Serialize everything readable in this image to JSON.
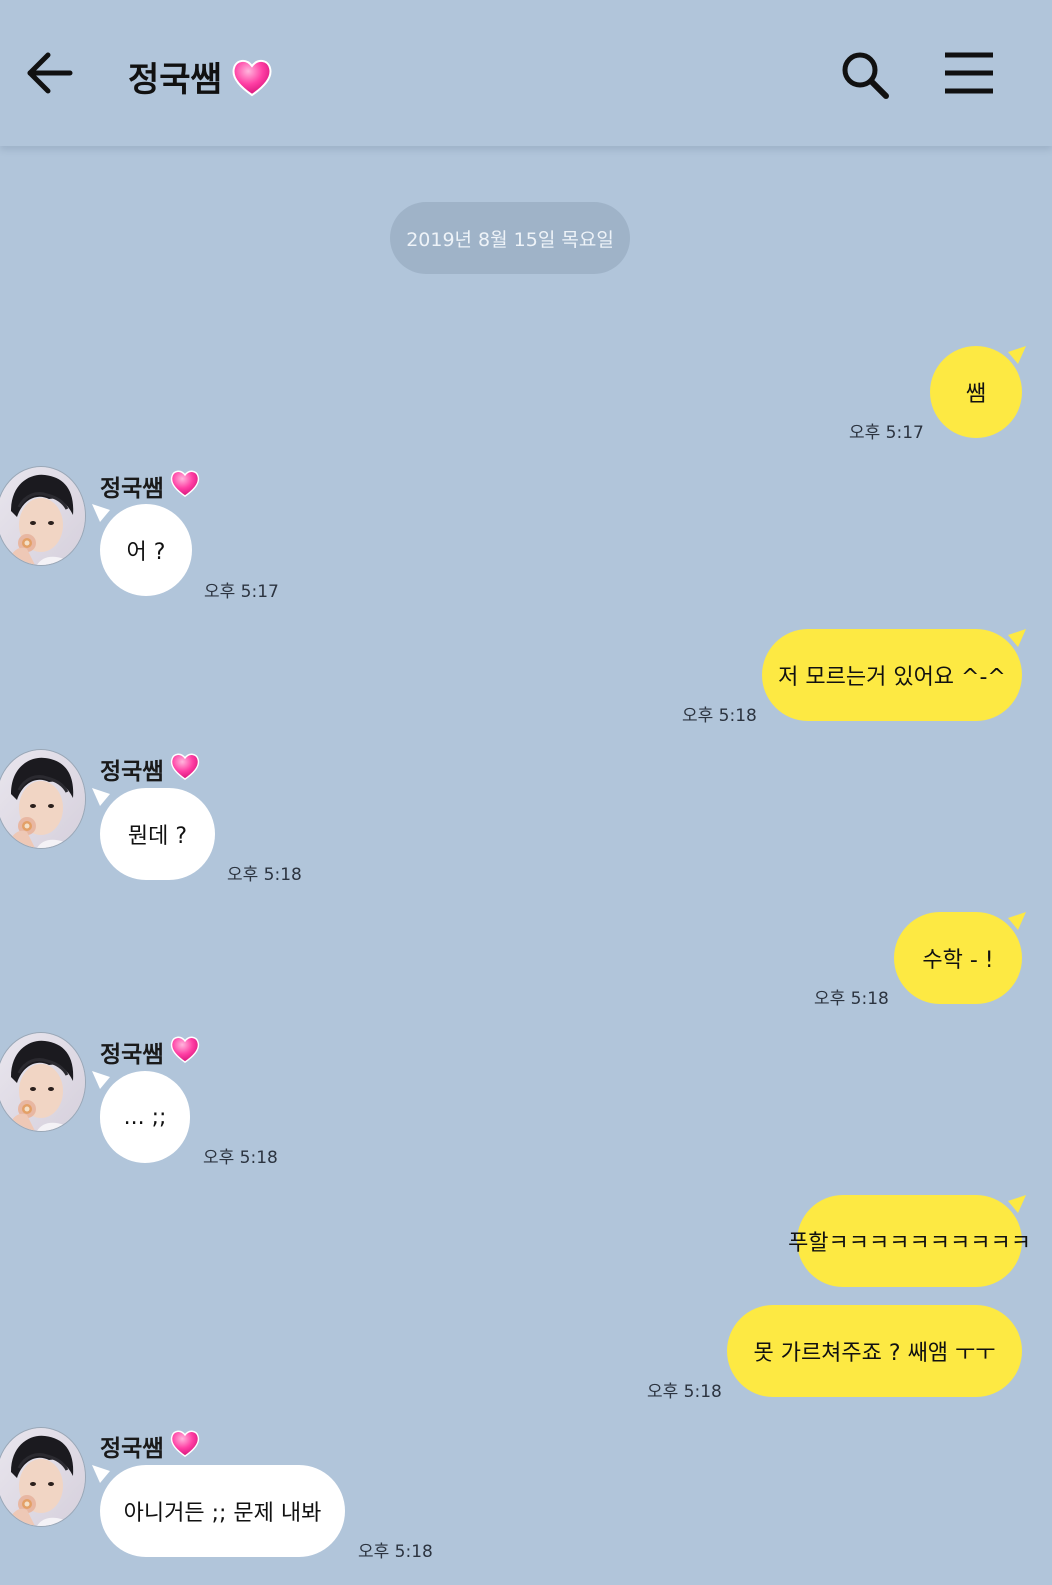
{
  "header": {
    "title": "정국쌤",
    "back_icon": "arrow-left-icon",
    "search_icon": "search-icon",
    "menu_icon": "hamburger-menu-icon",
    "title_emoji": "pink-heart-icon"
  },
  "date_divider": "2019년 8월 15일 목요일",
  "contact_name": "정국쌤",
  "messages": [
    {
      "from": "me",
      "text": "쌤",
      "time": "오후 5:17"
    },
    {
      "from": "them",
      "text": "어 ?",
      "time": "오후 5:17"
    },
    {
      "from": "me",
      "text": "저 모르는거 있어요 ^-^",
      "time": "오후 5:18"
    },
    {
      "from": "them",
      "text": "뭔데 ?",
      "time": "오후 5:18"
    },
    {
      "from": "me",
      "text": "수학 - !",
      "time": "오후 5:18"
    },
    {
      "from": "them",
      "text": "... ;;",
      "time": "오후 5:18"
    },
    {
      "from": "me",
      "text": "푸할ㅋㅋㅋㅋㅋㅋㅋㅋㅋㅋ"
    },
    {
      "from": "me",
      "text": "못 가르쳐주죠 ? 쌔앰 ㅜㅜ",
      "time": "오후 5:18"
    },
    {
      "from": "them",
      "text": "아니거든 ;; 문제 내봐",
      "time": "오후 5:18"
    }
  ],
  "colors": {
    "background": "#b1c5da",
    "my_bubble": "#fde943",
    "their_bubble": "#ffffff",
    "date_pill": "#9fb3c8",
    "heart": "#ff3fa4"
  }
}
